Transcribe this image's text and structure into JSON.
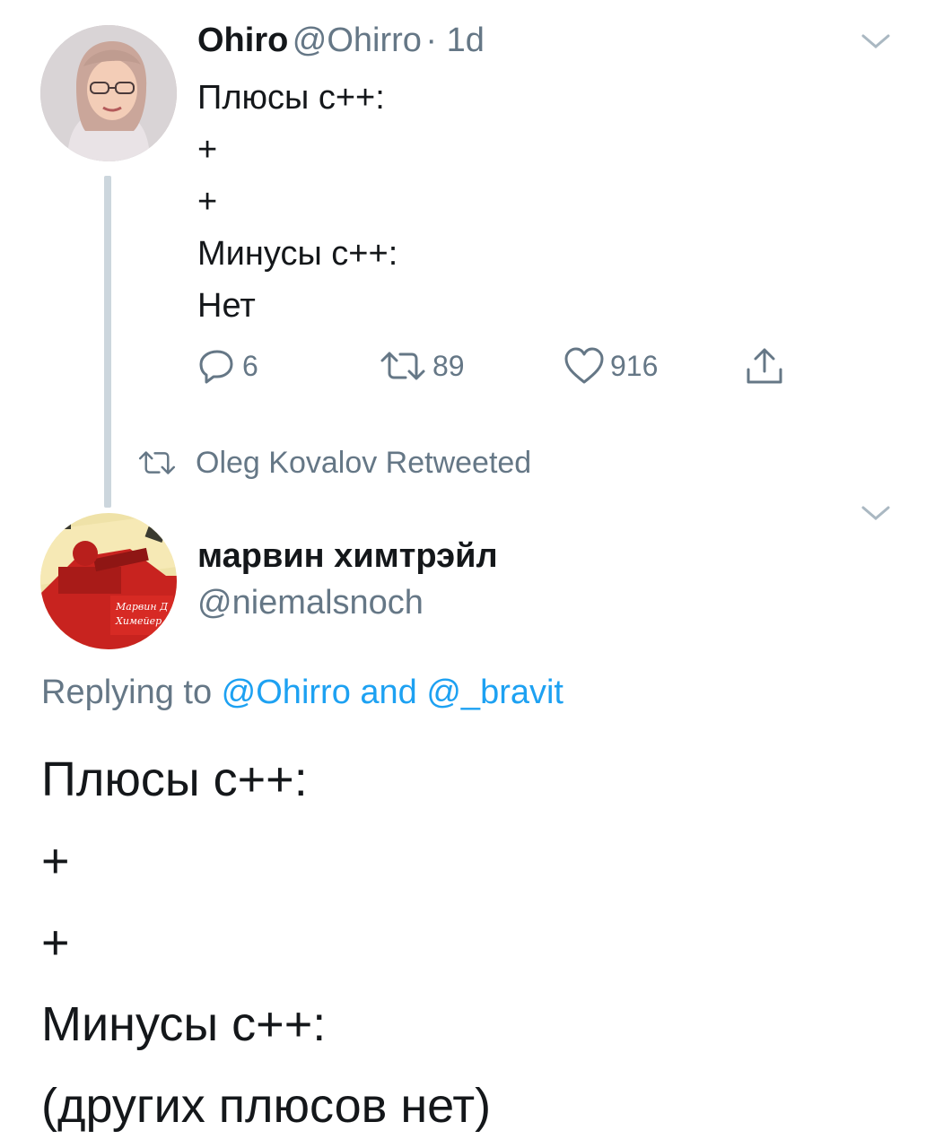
{
  "tweet1": {
    "name": "Ohiro",
    "handle": "@Ohirro",
    "time": "· 1d",
    "lines": [
      "Плюсы с++:",
      "+",
      "+",
      "Минусы с++:",
      "Нет"
    ],
    "stats": {
      "replies": "6",
      "retweets": "89",
      "likes": "916"
    }
  },
  "retweet_notice": "Oleg Kovalov Retweeted",
  "tweet2": {
    "name": "марвин химтрэйл",
    "handle": "@niemalsnoch",
    "replying_prefix": "Replying to ",
    "replying_to_1": "@Ohirro",
    "replying_and": " and ",
    "replying_to_2": "@_bravit",
    "lines": [
      "Плюсы с++:",
      "+",
      "+",
      "Минусы с++:",
      "(других плюсов нет)"
    ]
  },
  "colors": {
    "accent": "#1da1f2",
    "muted": "#657786",
    "thread": "#ccd6dd"
  },
  "icons": [
    "reply-icon",
    "retweet-icon",
    "like-icon",
    "share-icon",
    "chevron-down-icon"
  ]
}
